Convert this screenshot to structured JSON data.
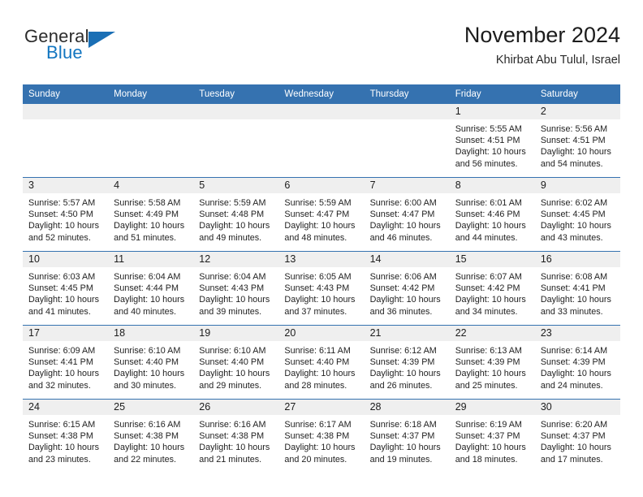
{
  "brand": {
    "word_one": "General",
    "word_two": "Blue",
    "logo_icon": "triangle-logo-icon",
    "accent_color": "#1a6fb5"
  },
  "header": {
    "title": "November 2024",
    "subtitle": "Khirbat Abu Tulul, Israel"
  },
  "calendar": {
    "header_bg": "#3572b0",
    "daynum_bg": "#efefef",
    "weekday_headers": [
      "Sunday",
      "Monday",
      "Tuesday",
      "Wednesday",
      "Thursday",
      "Friday",
      "Saturday"
    ],
    "weeks": [
      [
        {
          "day": "",
          "sunrise": "",
          "sunset": "",
          "daylight_line1": "",
          "daylight_line2": ""
        },
        {
          "day": "",
          "sunrise": "",
          "sunset": "",
          "daylight_line1": "",
          "daylight_line2": ""
        },
        {
          "day": "",
          "sunrise": "",
          "sunset": "",
          "daylight_line1": "",
          "daylight_line2": ""
        },
        {
          "day": "",
          "sunrise": "",
          "sunset": "",
          "daylight_line1": "",
          "daylight_line2": ""
        },
        {
          "day": "",
          "sunrise": "",
          "sunset": "",
          "daylight_line1": "",
          "daylight_line2": ""
        },
        {
          "day": "1",
          "sunrise": "Sunrise: 5:55 AM",
          "sunset": "Sunset: 4:51 PM",
          "daylight_line1": "Daylight: 10 hours",
          "daylight_line2": "and 56 minutes."
        },
        {
          "day": "2",
          "sunrise": "Sunrise: 5:56 AM",
          "sunset": "Sunset: 4:51 PM",
          "daylight_line1": "Daylight: 10 hours",
          "daylight_line2": "and 54 minutes."
        }
      ],
      [
        {
          "day": "3",
          "sunrise": "Sunrise: 5:57 AM",
          "sunset": "Sunset: 4:50 PM",
          "daylight_line1": "Daylight: 10 hours",
          "daylight_line2": "and 52 minutes."
        },
        {
          "day": "4",
          "sunrise": "Sunrise: 5:58 AM",
          "sunset": "Sunset: 4:49 PM",
          "daylight_line1": "Daylight: 10 hours",
          "daylight_line2": "and 51 minutes."
        },
        {
          "day": "5",
          "sunrise": "Sunrise: 5:59 AM",
          "sunset": "Sunset: 4:48 PM",
          "daylight_line1": "Daylight: 10 hours",
          "daylight_line2": "and 49 minutes."
        },
        {
          "day": "6",
          "sunrise": "Sunrise: 5:59 AM",
          "sunset": "Sunset: 4:47 PM",
          "daylight_line1": "Daylight: 10 hours",
          "daylight_line2": "and 48 minutes."
        },
        {
          "day": "7",
          "sunrise": "Sunrise: 6:00 AM",
          "sunset": "Sunset: 4:47 PM",
          "daylight_line1": "Daylight: 10 hours",
          "daylight_line2": "and 46 minutes."
        },
        {
          "day": "8",
          "sunrise": "Sunrise: 6:01 AM",
          "sunset": "Sunset: 4:46 PM",
          "daylight_line1": "Daylight: 10 hours",
          "daylight_line2": "and 44 minutes."
        },
        {
          "day": "9",
          "sunrise": "Sunrise: 6:02 AM",
          "sunset": "Sunset: 4:45 PM",
          "daylight_line1": "Daylight: 10 hours",
          "daylight_line2": "and 43 minutes."
        }
      ],
      [
        {
          "day": "10",
          "sunrise": "Sunrise: 6:03 AM",
          "sunset": "Sunset: 4:45 PM",
          "daylight_line1": "Daylight: 10 hours",
          "daylight_line2": "and 41 minutes."
        },
        {
          "day": "11",
          "sunrise": "Sunrise: 6:04 AM",
          "sunset": "Sunset: 4:44 PM",
          "daylight_line1": "Daylight: 10 hours",
          "daylight_line2": "and 40 minutes."
        },
        {
          "day": "12",
          "sunrise": "Sunrise: 6:04 AM",
          "sunset": "Sunset: 4:43 PM",
          "daylight_line1": "Daylight: 10 hours",
          "daylight_line2": "and 39 minutes."
        },
        {
          "day": "13",
          "sunrise": "Sunrise: 6:05 AM",
          "sunset": "Sunset: 4:43 PM",
          "daylight_line1": "Daylight: 10 hours",
          "daylight_line2": "and 37 minutes."
        },
        {
          "day": "14",
          "sunrise": "Sunrise: 6:06 AM",
          "sunset": "Sunset: 4:42 PM",
          "daylight_line1": "Daylight: 10 hours",
          "daylight_line2": "and 36 minutes."
        },
        {
          "day": "15",
          "sunrise": "Sunrise: 6:07 AM",
          "sunset": "Sunset: 4:42 PM",
          "daylight_line1": "Daylight: 10 hours",
          "daylight_line2": "and 34 minutes."
        },
        {
          "day": "16",
          "sunrise": "Sunrise: 6:08 AM",
          "sunset": "Sunset: 4:41 PM",
          "daylight_line1": "Daylight: 10 hours",
          "daylight_line2": "and 33 minutes."
        }
      ],
      [
        {
          "day": "17",
          "sunrise": "Sunrise: 6:09 AM",
          "sunset": "Sunset: 4:41 PM",
          "daylight_line1": "Daylight: 10 hours",
          "daylight_line2": "and 32 minutes."
        },
        {
          "day": "18",
          "sunrise": "Sunrise: 6:10 AM",
          "sunset": "Sunset: 4:40 PM",
          "daylight_line1": "Daylight: 10 hours",
          "daylight_line2": "and 30 minutes."
        },
        {
          "day": "19",
          "sunrise": "Sunrise: 6:10 AM",
          "sunset": "Sunset: 4:40 PM",
          "daylight_line1": "Daylight: 10 hours",
          "daylight_line2": "and 29 minutes."
        },
        {
          "day": "20",
          "sunrise": "Sunrise: 6:11 AM",
          "sunset": "Sunset: 4:40 PM",
          "daylight_line1": "Daylight: 10 hours",
          "daylight_line2": "and 28 minutes."
        },
        {
          "day": "21",
          "sunrise": "Sunrise: 6:12 AM",
          "sunset": "Sunset: 4:39 PM",
          "daylight_line1": "Daylight: 10 hours",
          "daylight_line2": "and 26 minutes."
        },
        {
          "day": "22",
          "sunrise": "Sunrise: 6:13 AM",
          "sunset": "Sunset: 4:39 PM",
          "daylight_line1": "Daylight: 10 hours",
          "daylight_line2": "and 25 minutes."
        },
        {
          "day": "23",
          "sunrise": "Sunrise: 6:14 AM",
          "sunset": "Sunset: 4:39 PM",
          "daylight_line1": "Daylight: 10 hours",
          "daylight_line2": "and 24 minutes."
        }
      ],
      [
        {
          "day": "24",
          "sunrise": "Sunrise: 6:15 AM",
          "sunset": "Sunset: 4:38 PM",
          "daylight_line1": "Daylight: 10 hours",
          "daylight_line2": "and 23 minutes."
        },
        {
          "day": "25",
          "sunrise": "Sunrise: 6:16 AM",
          "sunset": "Sunset: 4:38 PM",
          "daylight_line1": "Daylight: 10 hours",
          "daylight_line2": "and 22 minutes."
        },
        {
          "day": "26",
          "sunrise": "Sunrise: 6:16 AM",
          "sunset": "Sunset: 4:38 PM",
          "daylight_line1": "Daylight: 10 hours",
          "daylight_line2": "and 21 minutes."
        },
        {
          "day": "27",
          "sunrise": "Sunrise: 6:17 AM",
          "sunset": "Sunset: 4:38 PM",
          "daylight_line1": "Daylight: 10 hours",
          "daylight_line2": "and 20 minutes."
        },
        {
          "day": "28",
          "sunrise": "Sunrise: 6:18 AM",
          "sunset": "Sunset: 4:37 PM",
          "daylight_line1": "Daylight: 10 hours",
          "daylight_line2": "and 19 minutes."
        },
        {
          "day": "29",
          "sunrise": "Sunrise: 6:19 AM",
          "sunset": "Sunset: 4:37 PM",
          "daylight_line1": "Daylight: 10 hours",
          "daylight_line2": "and 18 minutes."
        },
        {
          "day": "30",
          "sunrise": "Sunrise: 6:20 AM",
          "sunset": "Sunset: 4:37 PM",
          "daylight_line1": "Daylight: 10 hours",
          "daylight_line2": "and 17 minutes."
        }
      ]
    ]
  }
}
